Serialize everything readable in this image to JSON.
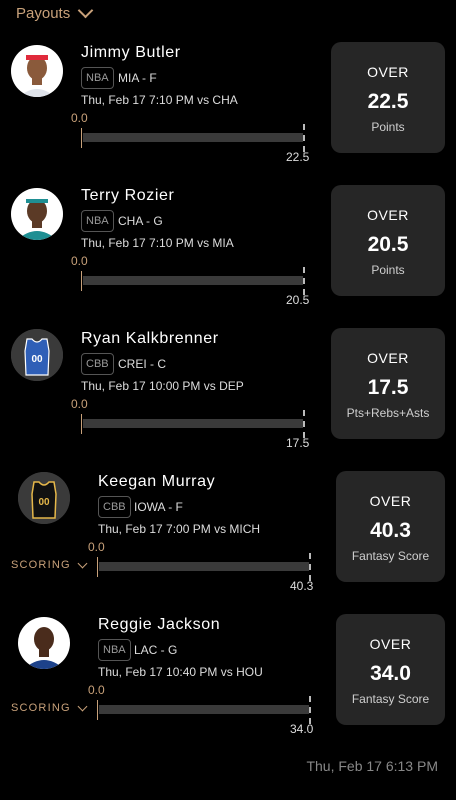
{
  "header": {
    "title": "Payouts"
  },
  "picks": [
    {
      "name": "Jimmy Butler",
      "league": "NBA",
      "team_pos": "MIA - F",
      "game": "Thu, Feb 17 7:10 PM vs CHA",
      "start": "0.0",
      "target": "22.5",
      "ou": "OVER",
      "line": "22.5",
      "stat": "Points",
      "scoring": null
    },
    {
      "name": "Terry Rozier",
      "league": "NBA",
      "team_pos": "CHA - G",
      "game": "Thu, Feb 17 7:10 PM vs MIA",
      "start": "0.0",
      "target": "20.5",
      "ou": "OVER",
      "line": "20.5",
      "stat": "Points",
      "scoring": null
    },
    {
      "name": "Ryan Kalkbrenner",
      "league": "CBB",
      "team_pos": "CREI - C",
      "game": "Thu, Feb 17 10:00 PM vs DEP",
      "start": "0.0",
      "target": "17.5",
      "ou": "OVER",
      "line": "17.5",
      "stat": "Pts+Rebs+Asts",
      "scoring": null,
      "jersey_number": "00"
    },
    {
      "name": "Keegan Murray",
      "league": "CBB",
      "team_pos": "IOWA - F",
      "game": "Thu, Feb 17 7:00 PM vs MICH",
      "start": "0.0",
      "target": "40.3",
      "ou": "OVER",
      "line": "40.3",
      "stat": "Fantasy Score",
      "scoring": "SCORING",
      "jersey_number": "00"
    },
    {
      "name": "Reggie Jackson",
      "league": "NBA",
      "team_pos": "LAC - G",
      "game": "Thu, Feb 17 10:40 PM vs HOU",
      "start": "0.0",
      "target": "34.0",
      "ou": "OVER",
      "line": "34.0",
      "stat": "Fantasy Score",
      "scoring": "SCORING"
    }
  ],
  "footer": {
    "timestamp": "Thu, Feb 17 6:13 PM"
  },
  "colors": {
    "accent": "#c8a17a",
    "background": "#000000",
    "card": "#262626",
    "track": "#3a3a3a"
  },
  "icons": {
    "dropdown": "chevron-down-icon",
    "avatar_photo": "player-photo",
    "avatar_jersey": "jersey-icon"
  }
}
